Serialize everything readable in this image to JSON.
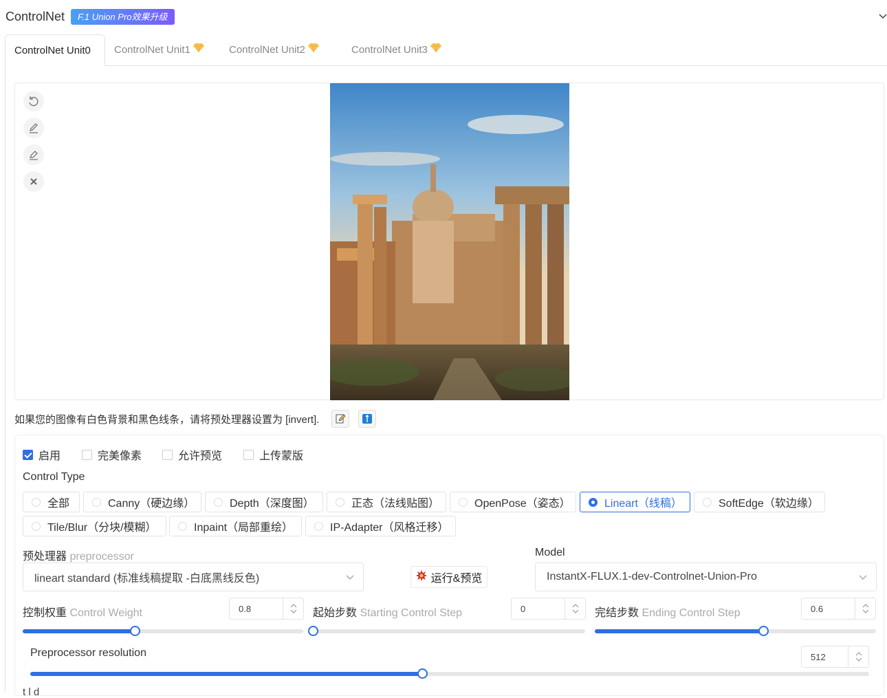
{
  "header": {
    "title": "ControlNet",
    "badge": "F.1 Union Pro效果升级"
  },
  "tabs": [
    {
      "label": "ControlNet Unit0",
      "active": true
    },
    {
      "label": "ControlNet Unit1",
      "active": false,
      "icon": "gem-icon"
    },
    {
      "label": "ControlNet Unit2",
      "active": false,
      "icon": "gem-icon"
    },
    {
      "label": "ControlNet Unit3",
      "active": false,
      "icon": "gem-icon"
    }
  ],
  "toolbar": {
    "icons": [
      "undo-icon",
      "brush-icon",
      "eraser-icon",
      "close-icon"
    ]
  },
  "hint": {
    "text": "如果您的图像有白色背景和黑色线条，请将预处理器设置为 [invert]."
  },
  "options": {
    "enable": "启用",
    "enable_checked": true,
    "pixel_perfect": "完美像素",
    "allow_preview": "允许预览",
    "upload_mask": "上传蒙版"
  },
  "control_type": {
    "label": "Control Type",
    "items": [
      "全部",
      "Canny（硬边缘）",
      "Depth（深度图）",
      "正态（法线贴图）",
      "OpenPose（姿态）",
      "Lineart（线稿）",
      "SoftEdge（软边缘）",
      "Tile/Blur（分块/模糊）",
      "Inpaint（局部重绘）",
      "IP-Adapter（风格迁移）"
    ],
    "selected": "Lineart（线稿）"
  },
  "preprocessor": {
    "label_zh": "预处理器",
    "label_en": "preprocessor",
    "value": "lineart standard (标准线稿提取 -白底黑线反色)"
  },
  "run_button": {
    "label": "运行&预览",
    "icon": "explosion-icon"
  },
  "model": {
    "label": "Model",
    "value": "InstantX-FLUX.1-dev-Controlnet-Union-Pro"
  },
  "control_weight": {
    "label_zh": "控制权重",
    "label_en": "Control Weight",
    "value": "0.8",
    "fraction": 0.4
  },
  "start_step": {
    "label_zh": "起始步数",
    "label_en": "Starting Control Step",
    "value": "0",
    "fraction": 0
  },
  "end_step": {
    "label_zh": "完结步数",
    "label_en": "Ending Control Step",
    "value": "0.6",
    "fraction": 0.6
  },
  "resolution": {
    "label": "Preprocessor resolution",
    "value": "512",
    "fraction": 0.467
  },
  "footer_partial": "  t  l     d",
  "colors": {
    "accent": "#2f6fe4",
    "border": "#e3e3e3"
  }
}
